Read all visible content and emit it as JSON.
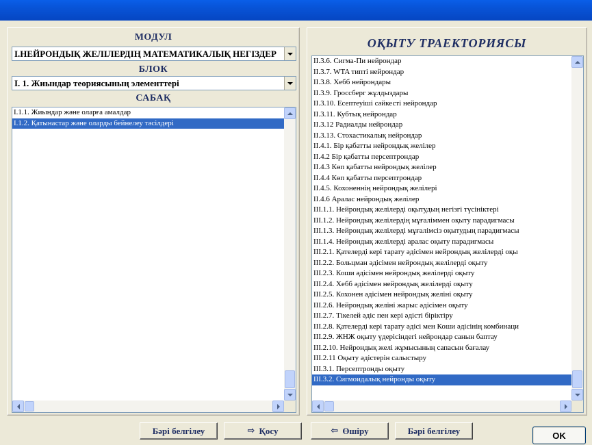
{
  "left": {
    "module_label": "МОДУЛ",
    "module_value": "I.НЕЙРОНДЫҚ ЖЕЛІЛЕРДІҢ МАТЕМАТИКАЛЫҚ НЕГІЗДЕР",
    "block_label": "БЛОК",
    "block_value": "I. 1. Жиындар теориясының элементтері",
    "lesson_label": "САБАҚ",
    "lessons": [
      "I.1.1. Жиындар және оларға амалдар",
      "I.1.2. Қатынастар және оларды бейнелеу тәсілдері"
    ]
  },
  "right": {
    "title": "ОҚЫТУ ТРАЕКТОРИЯСЫ",
    "items": [
      "II.3.6. Сигма-Пи нейрондар",
      "II.3.7. WTA типті нейрондар",
      "II.3.8. Хебб нейрондары",
      "II.3.9. Гроссберг жұлдыздары",
      "II.3.10. Есептеуіші сәйкесті нейрондар",
      "II.3.11. Кубтық нейрондар",
      "II.3.12 Радиалды нейрондар",
      "II.3.13. Стохастикалық нейрондар",
      "II.4.1. Бір қабатты нейрондық желілер",
      "II.4.2 Бір қабатты персептрондар",
      "II.4.3 Көп қабатты нейрондық желілер",
      "II.4.4 Көп қабатты персептрондар",
      "II.4.5. Кохоненнің нейрондық желілері",
      "II.4.6 Аралас нейрондық желілер",
      "III.1.1. Нейрондық желілерді оқытудың негізгі түсініктері",
      "III.1.2. Нейрондық желілердің мұғаліммен оқыту парадигмасы",
      "III.1.3. Нейрондық желілерді мұғалімсіз оқытудың парадигмасы",
      "III.1.4. Нейрондық желілерді аралас оқыту парадигмасы",
      "III.2.1. Қателерді кері тарату әдісімен нейрондық желілерді оқы",
      "III.2.2. Больцман әдісімен нейрондық желілерді оқыту",
      "III.2.3. Коши әдісімен нейрондық желілерді оқыту",
      "III.2.4. Хебб әдісімен нейрондық желілерді оқыту",
      "III.2.5.  Кохонен әдісімен нейрондық желіні оқыту",
      "III.2.6. Нейрондық желіні жарыс әдісімен оқыту",
      "III.2.7. Тікелей әдіс пен кері әдісті біріктіру",
      "III.2.8. Қателерді кері тарату әдісі мен Коши әдісінің комбинаци",
      "III.2.9. ЖНЖ оқыту үдерісіндегі нейрондар санын баптау",
      "III.2.10. Нейрондық желі жұмысының сапасын бағалау",
      "III.2.11 Оқыту әдістерін салыстыру",
      "III.3.1. Персептронды оқыту",
      "III.3.2. Сигмоидалық нейронды оқыту"
    ]
  },
  "buttons": {
    "select_all_left": "Бәрі белгілеу",
    "add": "Қосу",
    "remove": "Өшіру",
    "select_all_right": "Бәрі белгілеу",
    "ok": "OK"
  },
  "colors": {
    "selection": "#316AC5",
    "title_bar": "#0A5FE8",
    "label_text": "#1F2E63"
  }
}
